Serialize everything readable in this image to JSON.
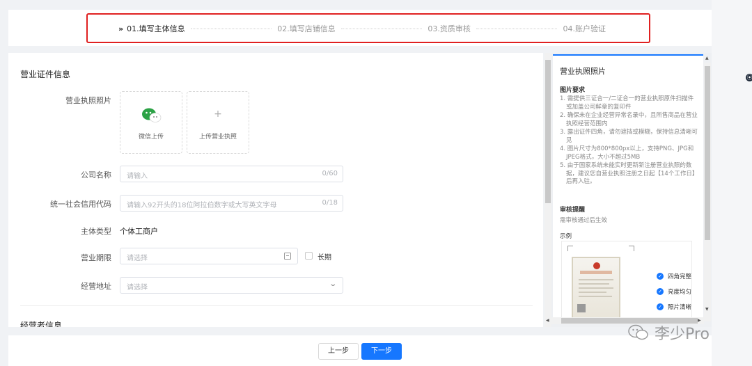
{
  "steps": [
    {
      "label": "01.填写主体信息",
      "active": true
    },
    {
      "label": "02.填写店铺信息",
      "active": false
    },
    {
      "label": "03.资质审核",
      "active": false
    },
    {
      "label": "04.账户验证",
      "active": false
    }
  ],
  "form": {
    "section_title": "营业证件信息",
    "section2_title": "经营者信息",
    "license_photo_label": "营业执照照片",
    "wechat_upload": "微信上传",
    "upload_license": "上传营业执照",
    "company_name": {
      "label": "公司名称",
      "placeholder": "请输入",
      "count": "0/60"
    },
    "credit_code": {
      "label": "统一社会信用代码",
      "placeholder": "请输入92开头的18位阿拉伯数字或大写英文字母",
      "count": "0/18"
    },
    "entity_type": {
      "label": "主体类型",
      "value": "个体工商户"
    },
    "business_term": {
      "label": "营业期限",
      "placeholder": "请选择",
      "long_term": "长期"
    },
    "business_address": {
      "label": "经营地址",
      "placeholder": "请选择"
    }
  },
  "side": {
    "title": "营业执照照片",
    "req_heading": "图片要求",
    "requirements": [
      "1. 需提供三证合一/二证合一的营业执照原件扫描件或加盖公司鲜章的复印件",
      "2. 确保未在企业经营异常名录中，且所售商品在营业执照经营范围内",
      "3. 露出证件四角，请勿遮挡或模糊，保持信息清晰可见",
      "4. 图片尺寸为800*800px以上，支持PNG、JPG和JPEG格式，大小不超过5MB",
      "5. 由于国家系统未能实时更新新注册营业执照的数据，建议您自营业执照注册之日起【14个工作日】后再入驻。"
    ],
    "review_heading": "审核提醒",
    "review_text": "需审核通过后生效",
    "example_heading": "示例",
    "checks": [
      "四角完整",
      "亮度均匀",
      "照片清晰"
    ]
  },
  "buttons": {
    "prev": "上一步",
    "next": "下一步"
  },
  "watermark": "李少Pro",
  "colors": {
    "primary": "#1677ff",
    "highlight": "#e02020"
  }
}
